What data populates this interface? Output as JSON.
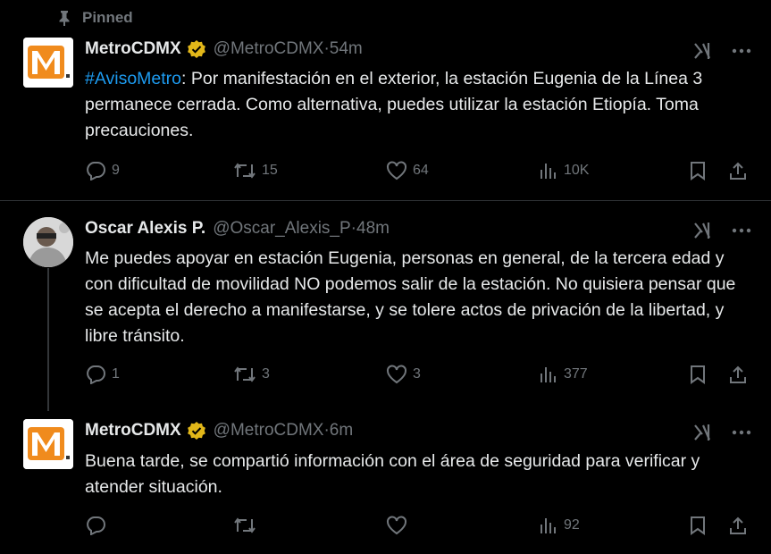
{
  "pinned_label": "Pinned",
  "tweets": [
    {
      "author": "MetroCDMX",
      "handle": "@MetroCDMX",
      "time": "54m",
      "hashtag": "#AvisoMetro",
      "text": ": Por manifestación en el exterior, la estación Eugenia de la Línea 3 permanece cerrada. Como alternativa, puedes utilizar la estación Etiopía. Toma precauciones.",
      "replies": "9",
      "reposts": "15",
      "likes": "64",
      "views": "10K"
    },
    {
      "author": "Oscar Alexis P.",
      "handle": "@Oscar_Alexis_P",
      "time": "48m",
      "text": "Me puedes apoyar en estación Eugenia, personas en general, de la tercera edad y con dificultad de movilidad NO podemos salir de la estación. No quisiera pensar que se acepta el derecho a manifestarse, y se tolere actos de privación de la libertad, y libre tránsito.",
      "replies": "1",
      "reposts": "3",
      "likes": "3",
      "views": "377"
    },
    {
      "author": "MetroCDMX",
      "handle": "@MetroCDMX",
      "time": "6m",
      "text": "Buena tarde, se compartió información con el área de seguridad para verificar y atender situación.",
      "replies": "",
      "reposts": "",
      "likes": "",
      "views": "92"
    }
  ],
  "colors": {
    "background": "#000000",
    "text": "#e7e9ea",
    "muted": "#71767b",
    "link": "#1d9bf0",
    "verified": "#e2b719",
    "metro_orange": "#f08b1d"
  },
  "icons": [
    "pin-icon",
    "verified-badge-icon",
    "grok-icon",
    "more-icon",
    "reply-icon",
    "repost-icon",
    "like-icon",
    "views-icon",
    "bookmark-icon",
    "share-icon"
  ],
  "sep": " · "
}
